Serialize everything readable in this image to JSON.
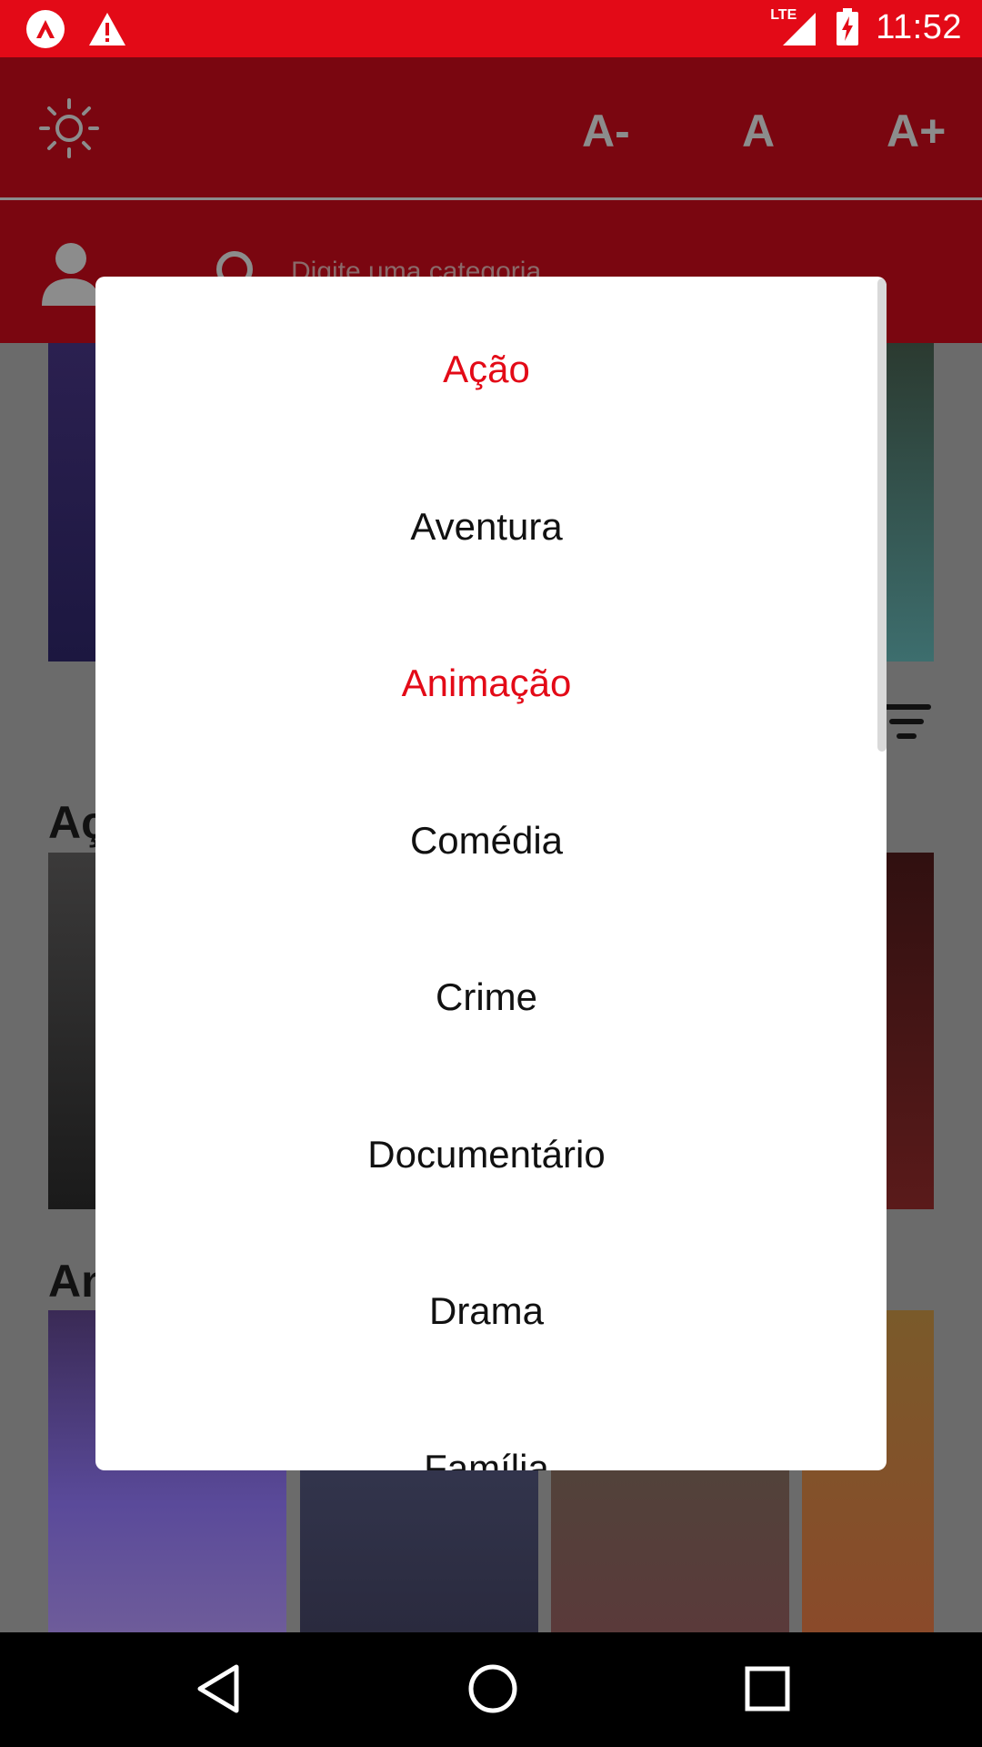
{
  "status_bar": {
    "time": "11:52",
    "network": "LTE",
    "icons": [
      "app-logo-icon",
      "warning-icon",
      "signal-icon",
      "battery-charging-icon"
    ]
  },
  "toolbar": {
    "theme_icon": "sun-icon",
    "font_decrease_label": "A-",
    "font_normal_label": "A",
    "font_increase_label": "A+"
  },
  "search": {
    "placeholder": "Digite uma categoria"
  },
  "sections": {
    "first_title": "Aç",
    "second_title": "An"
  },
  "dialog": {
    "options": [
      {
        "label": "Ação",
        "selected": true
      },
      {
        "label": "Aventura",
        "selected": false
      },
      {
        "label": "Animação",
        "selected": true
      },
      {
        "label": "Comédia",
        "selected": false
      },
      {
        "label": "Crime",
        "selected": false
      },
      {
        "label": "Documentário",
        "selected": false
      },
      {
        "label": "Drama",
        "selected": false
      },
      {
        "label": "Família",
        "selected": false
      }
    ]
  },
  "colors": {
    "accent": "#e30a17",
    "toolbar_dimmed": "#7a0610",
    "dialog_bg": "#ffffff"
  },
  "nav": {
    "icons": [
      "back-icon",
      "home-icon",
      "recents-icon"
    ]
  }
}
